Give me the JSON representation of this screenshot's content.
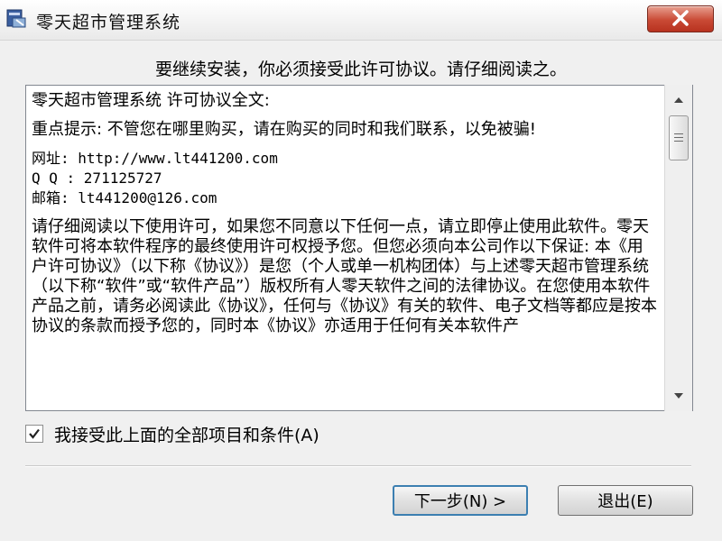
{
  "window": {
    "title": "零天超市管理系统",
    "close_icon": "close-icon"
  },
  "instruction": "要继续安装，你必须接受此许可协议。请仔细阅读之。",
  "license": {
    "heading": "零天超市管理系统 许可协议全文:",
    "notice": "重点提示: 不管您在哪里购买，请在购买的同时和我们联系，以免被骗!",
    "website": "网址: http://www.lt441200.com",
    "qq": "Q Q : 271125727",
    "email": "邮箱: lt441200@126.com",
    "body": "请仔细阅读以下使用许可，如果您不同意以下任何一点，请立即停止使用此软件。零天软件可将本软件程序的最终使用许可权授予您。但您必须向本公司作以下保证: 本《用户许可协议》（以下称《协议》）是您（个人或单一机构团体）与上述零天超市管理系统（以下称“软件”或“软件产品”）版权所有人零天软件之间的法律协议。在您使用本软件产品之前，请务必阅读此《协议》，任何与《协议》有关的软件、电子文档等都应是按本协议的条款而授予您的，同时本《协议》亦适用于任何有关本软件产"
  },
  "accept_checkbox": {
    "checked": true,
    "label": "我接受此上面的全部项目和条件(A)"
  },
  "buttons": {
    "next_label": "下一步(N) >",
    "exit_label": "退出(E)"
  }
}
